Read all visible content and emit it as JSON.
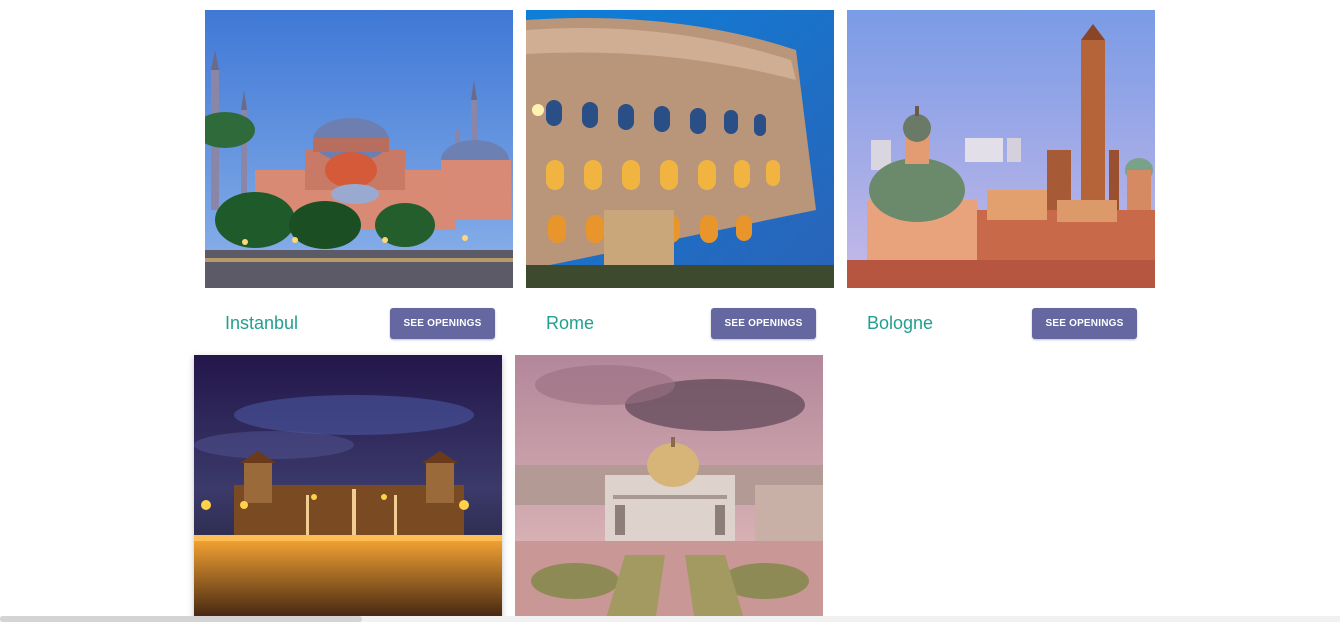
{
  "cities": [
    {
      "name": "Instanbul",
      "button_label": "SEE OPENINGS"
    },
    {
      "name": "Rome",
      "button_label": "SEE OPENINGS"
    },
    {
      "name": "Bologne",
      "button_label": "SEE OPENINGS"
    }
  ],
  "photos": [
    {
      "subject": "instanbul-mosque-photo"
    },
    {
      "subject": "rome-colosseum-photo"
    },
    {
      "subject": "bologne-skyline-photo"
    },
    {
      "subject": "night-palace-fountain-photo"
    },
    {
      "subject": "mexico-palace-photo"
    }
  ],
  "colors": {
    "caption": "#22a08f",
    "button": "#6568a0",
    "button_text": "#ffffff"
  }
}
